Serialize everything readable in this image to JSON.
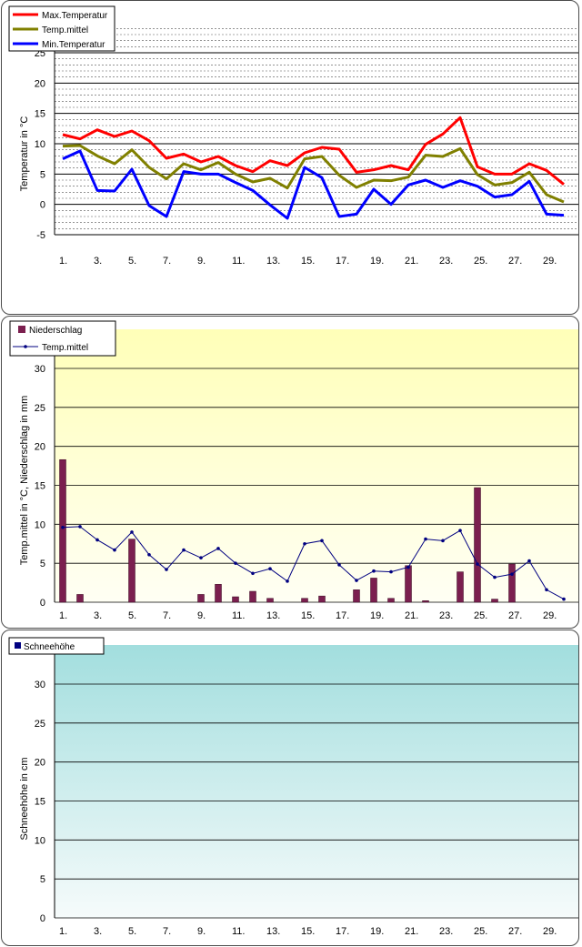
{
  "chart_data": [
    {
      "type": "line",
      "ylabel": "Temperatur in °C",
      "ylim": [
        -5,
        25
      ],
      "ytick_step": 5,
      "x": [
        1,
        2,
        3,
        4,
        5,
        6,
        7,
        8,
        9,
        10,
        11,
        12,
        13,
        14,
        15,
        16,
        17,
        18,
        19,
        20,
        21,
        22,
        23,
        24,
        25,
        26,
        27,
        28,
        29,
        30
      ],
      "xtick_labels": [
        "1.",
        "3.",
        "5.",
        "7.",
        "9.",
        "11.",
        "13.",
        "15.",
        "17.",
        "19.",
        "21.",
        "23.",
        "25.",
        "27.",
        "29."
      ],
      "legend": "top-left",
      "series": [
        {
          "name": "Max.Temperatur",
          "color": "#ff0000",
          "values": [
            11.5,
            10.8,
            12.3,
            11.2,
            12.1,
            10.5,
            7.6,
            8.3,
            7.0,
            7.9,
            6.4,
            5.4,
            7.2,
            6.4,
            8.5,
            9.4,
            9.1,
            5.3,
            5.7,
            6.4,
            5.7,
            9.9,
            11.6,
            14.3,
            6.2,
            5.0,
            5.0,
            6.7,
            5.6,
            3.3
          ]
        },
        {
          "name": "Temp.mittel",
          "color": "#808000",
          "values": [
            9.6,
            9.7,
            8.0,
            6.7,
            9.0,
            6.1,
            4.2,
            6.7,
            5.7,
            6.9,
            5.0,
            3.7,
            4.3,
            2.7,
            7.5,
            7.9,
            4.8,
            2.8,
            4.0,
            3.9,
            4.5,
            8.1,
            7.9,
            9.2,
            4.9,
            3.2,
            3.6,
            5.3,
            1.6,
            0.4
          ]
        },
        {
          "name": "Min.Temperatur",
          "color": "#0000ff",
          "values": [
            7.5,
            8.8,
            2.3,
            2.2,
            5.8,
            -0.2,
            -2.0,
            5.4,
            5.0,
            5.0,
            3.6,
            2.3,
            -0.1,
            -2.3,
            6.1,
            4.4,
            -2.0,
            -1.6,
            2.5,
            0.0,
            3.2,
            4.0,
            2.8,
            3.9,
            3.0,
            1.2,
            1.6,
            3.8,
            -1.6,
            -1.8
          ]
        }
      ]
    },
    {
      "type": "bar",
      "ylabel": "Temp.mittel  in °C, Niederschlag in mm",
      "ylim": [
        0,
        30
      ],
      "ytick_step": 5,
      "x": [
        1,
        2,
        3,
        4,
        5,
        6,
        7,
        8,
        9,
        10,
        11,
        12,
        13,
        14,
        15,
        16,
        17,
        18,
        19,
        20,
        21,
        22,
        23,
        24,
        25,
        26,
        27,
        28,
        29,
        30
      ],
      "xtick_labels": [
        "1.",
        "3.",
        "5.",
        "7.",
        "9.",
        "11.",
        "13.",
        "15.",
        "17.",
        "19.",
        "21.",
        "23.",
        "25.",
        "27.",
        "29."
      ],
      "legend": "top-left",
      "series": [
        {
          "name": "Niederschlag",
          "color": "#7b1f4f",
          "kind": "bar",
          "values": [
            18.3,
            1.0,
            0,
            0,
            8.1,
            0,
            0,
            0,
            1.0,
            2.3,
            0.7,
            1.4,
            0.5,
            0,
            0.5,
            0.8,
            0,
            1.6,
            3.1,
            0.5,
            4.7,
            0.2,
            0,
            3.9,
            14.7,
            0.4,
            4.9,
            0,
            0,
            0
          ]
        },
        {
          "name": "Temp.mittel",
          "color": "#000080",
          "kind": "line",
          "values": [
            9.6,
            9.7,
            8.0,
            6.7,
            9.0,
            6.1,
            4.2,
            6.7,
            5.7,
            6.9,
            5.0,
            3.7,
            4.3,
            2.7,
            7.5,
            7.9,
            4.8,
            2.8,
            4.0,
            3.9,
            4.5,
            8.1,
            7.9,
            9.2,
            4.9,
            3.2,
            3.6,
            5.3,
            1.6,
            0.4
          ]
        }
      ]
    },
    {
      "type": "bar",
      "ylabel": "Schneehöhe in cm",
      "ylim": [
        0,
        35
      ],
      "ytick_step": 5,
      "x": [
        1,
        2,
        3,
        4,
        5,
        6,
        7,
        8,
        9,
        10,
        11,
        12,
        13,
        14,
        15,
        16,
        17,
        18,
        19,
        20,
        21,
        22,
        23,
        24,
        25,
        26,
        27,
        28,
        29,
        30
      ],
      "xtick_labels": [
        "1.",
        "3.",
        "5.",
        "7.",
        "9.",
        "11.",
        "13.",
        "15.",
        "17.",
        "19.",
        "21.",
        "23.",
        "25.",
        "27.",
        "29."
      ],
      "legend": "top-left",
      "series": [
        {
          "name": "Schneehöhe",
          "color": "#000080",
          "values": [
            0,
            0,
            0,
            0,
            0,
            0,
            0,
            0,
            0,
            0,
            0,
            0,
            0,
            0,
            0,
            0,
            0,
            0,
            0,
            0,
            0,
            0,
            0,
            0,
            0,
            0,
            0,
            0,
            0,
            0
          ]
        }
      ]
    }
  ]
}
